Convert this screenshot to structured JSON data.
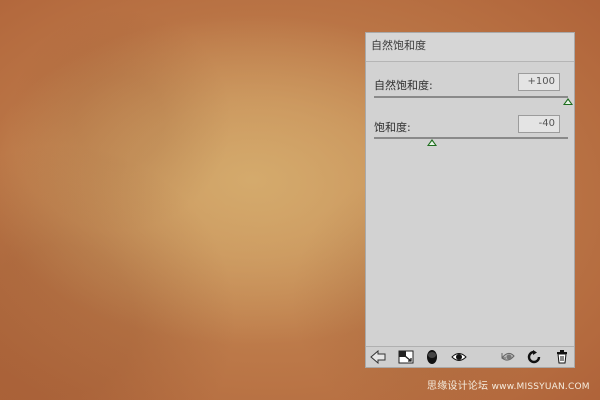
{
  "panel": {
    "title": "自然饱和度",
    "vibrance": {
      "label": "自然饱和度:",
      "value": "+100",
      "level": 100
    },
    "saturation": {
      "label": "饱和度:",
      "value": "-40",
      "level": -40
    }
  },
  "toolbar": {
    "icons": [
      "back-arrow-icon",
      "expand-view-icon",
      "clip-layer-icon",
      "eye-visibility-icon",
      "previous-state-icon",
      "reset-icon",
      "trash-icon"
    ]
  },
  "watermark": {
    "cn": "思缘设计论坛",
    "en": "www.MISSYUAN.COM"
  }
}
